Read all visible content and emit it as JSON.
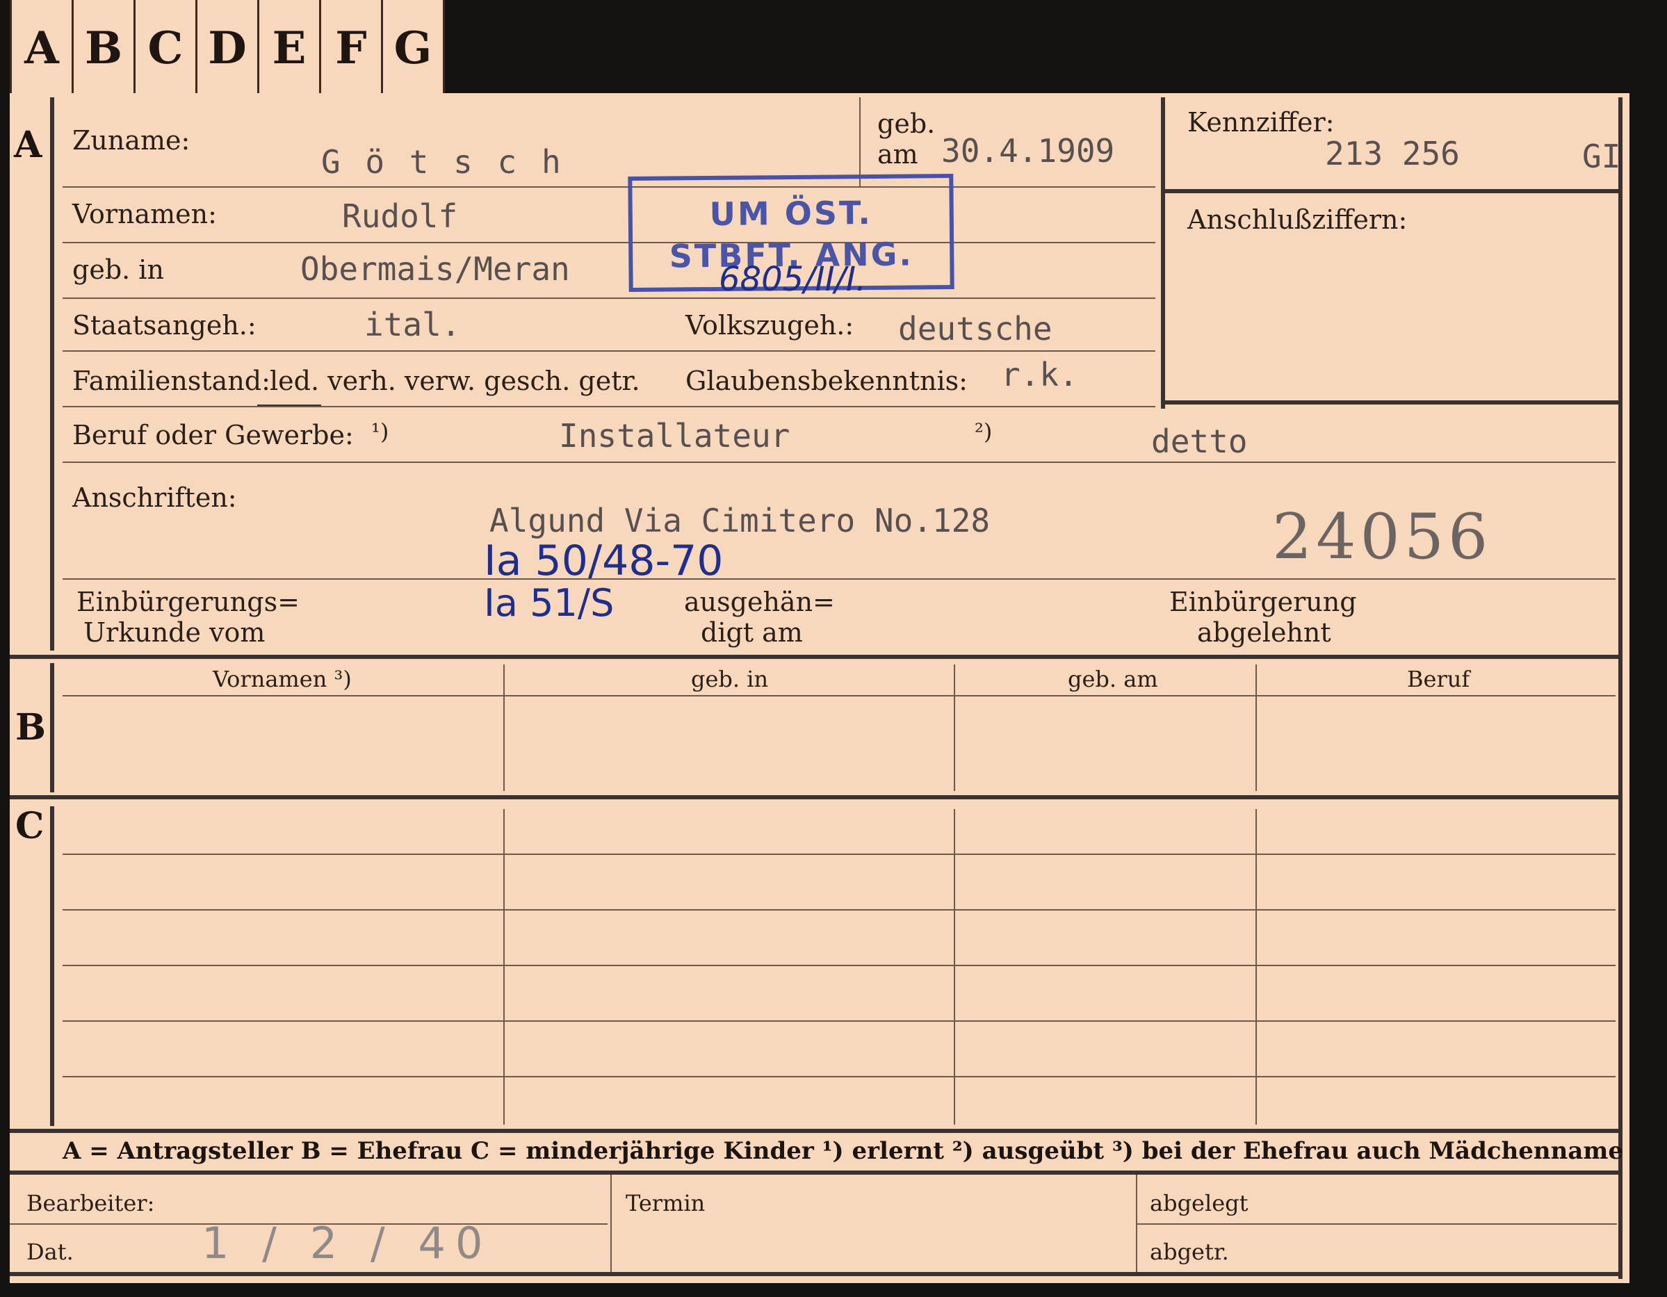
{
  "tabs": [
    "A",
    "B",
    "C",
    "D",
    "E",
    "F",
    "G"
  ],
  "sections": {
    "a": "A",
    "b": "B",
    "c": "C"
  },
  "labels": {
    "zuname": "Zuname:",
    "geb_am_1": "geb.",
    "geb_am_2": "am",
    "kennziffer": "Kennziffer:",
    "vornamen": "Vornamen:",
    "anschluss": "Anschlußziffern:",
    "geb_in": "geb. in",
    "staatsangeh": "Staatsangeh.:",
    "volkszugeh": "Volkszugeh.:",
    "familienstand": "Familienstand:",
    "fam_options": "led. verh. verw. gesch. getr.",
    "glaubens": "Glaubensbekenntnis:",
    "beruf": "Beruf oder Gewerbe:",
    "beruf_note1": "¹)",
    "beruf_note2": "²)",
    "anschriften": "Anschriften:",
    "einbuerg_1": "Einbürgerungs=",
    "einbuerg_2": "Urkunde vom",
    "ausgehaen_1": "ausgehän=",
    "ausgehaen_2": "digt am",
    "abgelehnt_1": "Einbürgerung",
    "abgelehnt_2": "abgelehnt"
  },
  "values": {
    "zuname": "G ö t s c h",
    "geb_am": "30.4.1909",
    "kennziffer": "213 256",
    "kennziffer_suffix": "GI",
    "vornamen": "Rudolf",
    "geb_in": "Obermais/Meran",
    "staatsangeh": "ital.",
    "volkszugeh": "deutsche",
    "glaubens": "r.k.",
    "beruf_erlernt": "Installateur",
    "beruf_ausgeuebt": "detto",
    "anschrift": "Algund Via Cimitero No.128",
    "record_number": "24056"
  },
  "stamp": {
    "line1": "UM ÖST.",
    "line2": "STBFT. ANG."
  },
  "handwriting": {
    "stamp_ref": "6805/II/I.",
    "ref1": "Ia 50/48-70",
    "ref2": "Ia 51/S",
    "date": "1 / 2 / 40"
  },
  "table_headers": [
    "Vornamen ³)",
    "geb. in",
    "geb. am",
    "Beruf"
  ],
  "legend": "A = Antragsteller   B = Ehefrau   C = minderjährige Kinder   ¹) erlernt   ²) ausgeübt   ³) bei der Ehefrau auch Mädchenname",
  "footer": {
    "bearbeiter": "Bearbeiter:",
    "dat": "Dat.",
    "termin": "Termin",
    "abgelegt": "abgelegt",
    "abgetr": "abgetr."
  }
}
